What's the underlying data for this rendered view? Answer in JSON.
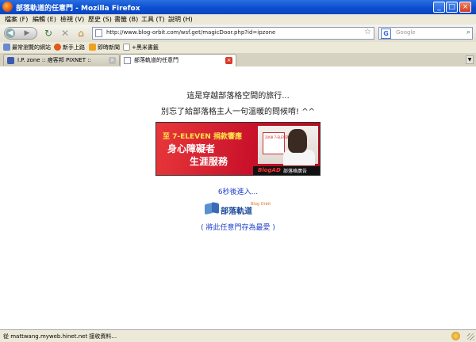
{
  "window": {
    "title": "部落軌道的任意門 - Mozilla Firefox"
  },
  "menu": [
    "檔案 (F)",
    "編輯 (E)",
    "檢視 (V)",
    "歷史 (S)",
    "書籤 (B)",
    "工具 (T)",
    "說明 (H)"
  ],
  "nav": {
    "url": "http://www.blog-orbit.com/wsf.get/magicDoor.php?id=ipzone",
    "search_placeholder": "Google",
    "search_engine_letter": "G"
  },
  "bookmarks": [
    {
      "label": "最常瀏覽的網站",
      "icon": "star-icon"
    },
    {
      "label": "新手上路",
      "icon": "firefox-icon"
    },
    {
      "label": "即時新聞",
      "icon": "rss-icon"
    },
    {
      "label": "+黑米書籤",
      "icon": "page-icon"
    }
  ],
  "tabs": [
    {
      "label": "I.P. zone :: 痞客邦 PIXNET ::",
      "active": false
    },
    {
      "label": "部落軌道的任意門",
      "active": true
    }
  ],
  "content": {
    "line1": "這是穿越部落格空間的旅行...",
    "line2": "別忘了給部落格主人一句溫暖的問候唷! ^^",
    "banner": {
      "line1": "至 7-ELEVEN 捐款響應",
      "line2": "身心障礙者",
      "line3": "生涯服務",
      "card_text": "2008 7-ELEVEN 好運阿你",
      "footer_brand": "BlogAD",
      "footer_label": "部落格廣告"
    },
    "countdown": "6秒後進入...",
    "logo": {
      "text": "部落軌道",
      "subtext": "Blog Orbit"
    },
    "favorite_link": "( 將此任意門存為最愛 )"
  },
  "status": {
    "text": "從 mattwang.myweb.hinet.net 接收資料..."
  },
  "colors": {
    "link": "#2244cc",
    "titlebar": "#0b4ed0",
    "banner_red": "#c8102a"
  }
}
